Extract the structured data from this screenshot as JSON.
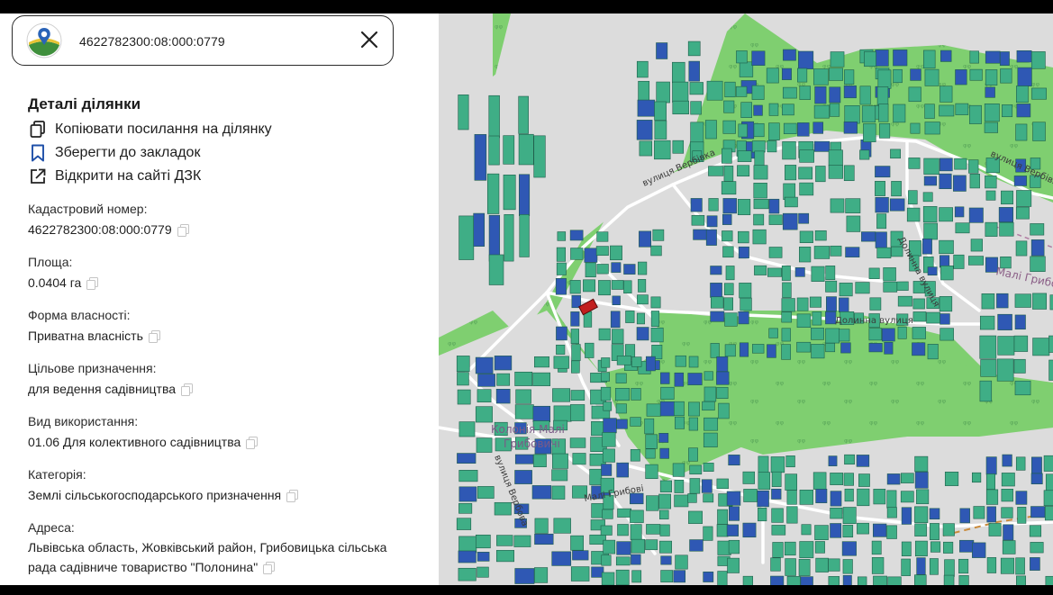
{
  "search": {
    "value": "4622782300:08:000:0779"
  },
  "details": {
    "title": "Деталі ділянки",
    "actions": [
      {
        "label": "Копіювати посилання на ділянку",
        "icon": "copy-link-icon"
      },
      {
        "label": "Зберегти до закладок",
        "icon": "bookmark-icon"
      },
      {
        "label": "Відкрити на сайті ДЗК",
        "icon": "external-link-icon"
      }
    ],
    "fields": [
      {
        "label": "Кадастровий номер:",
        "value": "4622782300:08:000:0779"
      },
      {
        "label": "Площа:",
        "value": "0.0404 га"
      },
      {
        "label": "Форма власності:",
        "value": "Приватна власність"
      },
      {
        "label": "Цільове призначення:",
        "value": "для ведення садівництва"
      },
      {
        "label": "Вид використання:",
        "value": "01.06 Для колективного садівництва"
      },
      {
        "label": "Категорія:",
        "value": "Землі сільськогосподарського призначення"
      },
      {
        "label": "Адреса:",
        "value_line1": "Львівська область, Жовківський район, Грибовицька сільська",
        "value_line2": "рада садівниче товариство \"Полонина\""
      }
    ]
  },
  "map": {
    "labels": {
      "street_verbivka": "вулиця Вербівка",
      "street_verbivka_right": "вулиця Вербівка",
      "street_dolynna_1": "Долинна вулиця",
      "street_dolynna_2": "Долинна вулиця",
      "village": "Малі Грибовичі",
      "colony_line1": "Колонія Малі",
      "colony_line2": "Грибовичі",
      "street_verbova": "вулиця Вербова",
      "street_mali_gryb": "Малі Грибові"
    },
    "colors": {
      "forest": "#7fcf70",
      "built_area": "#dcdcdc",
      "parcel_green": "#3fae86",
      "parcel_blue": "#2f58b4",
      "selected_parcel": "#c21f1f"
    }
  }
}
